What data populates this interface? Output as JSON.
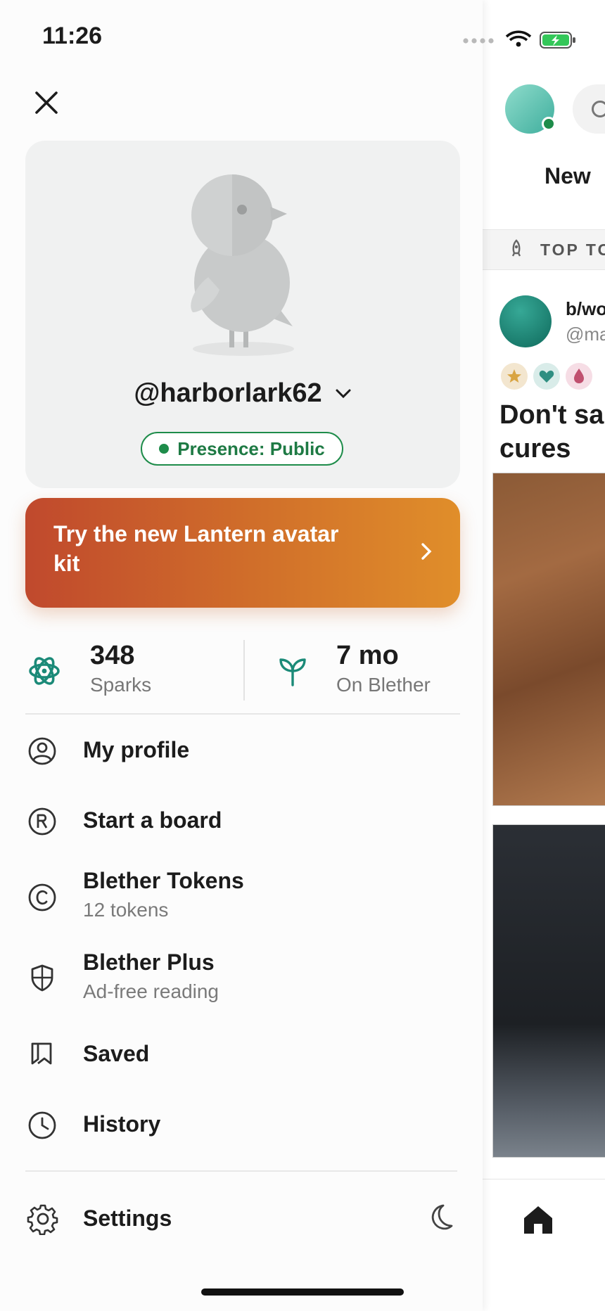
{
  "status_bar": {
    "time": "11:26"
  },
  "drawer": {
    "profile": {
      "username": "@harborlark62",
      "presence": "Presence: Public"
    },
    "promo": {
      "text": "Try the new Lantern avatar kit"
    },
    "stats": [
      {
        "value": "348",
        "label": "Sparks",
        "icon": "atom-icon"
      },
      {
        "value": "7 mo",
        "label": "On Blether",
        "icon": "sprout-icon"
      }
    ],
    "menu": [
      {
        "label": "My profile",
        "icon": "user-circle-icon"
      },
      {
        "label": "Start a board",
        "icon": "registered-icon"
      },
      {
        "label": "Blether Tokens",
        "sub": "12 tokens",
        "icon": "copyright-icon"
      },
      {
        "label": "Blether Plus",
        "sub": "Ad-free reading",
        "icon": "shield-icon"
      },
      {
        "label": "Saved",
        "icon": "bookmark-icon"
      },
      {
        "label": "History",
        "icon": "clock-icon"
      }
    ],
    "settings_label": "Settings"
  },
  "background_feed": {
    "tab": "New",
    "section": "TOP TO",
    "post": {
      "board": "b/wo",
      "user": "@ma",
      "title_line1": "Don't sa",
      "title_line2": "cures"
    }
  },
  "colors": {
    "presence_green": "#1e8c4a",
    "promo_start": "#c0492d",
    "promo_end": "#e08e2a",
    "stat_icon_teal": "#1b8a78"
  }
}
